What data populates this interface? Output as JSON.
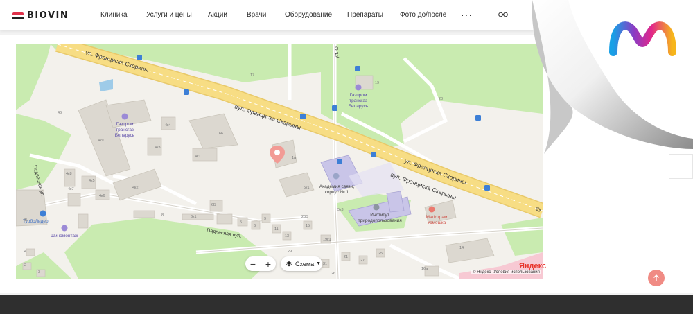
{
  "header": {
    "logo_text": "BIOVIN",
    "nav": [
      "Клиника",
      "Услуги и цены",
      "Акции",
      "Врачи",
      "Оборудование",
      "Препараты",
      "Фото до/после"
    ],
    "more": "···"
  },
  "map": {
    "streets": {
      "skaryny_top": "ул. Франциска Скорины",
      "skaryny_mid": "вул. Франциска Скарыны",
      "skaryny_right1": "ул. Франциска Скорины",
      "skaryny_right2": "вул. Франциска Скарыны",
      "padlesnaya": "Падлесная вул.",
      "podlesnaya": "Подлесная ул.",
      "cut_o": "ул. О",
      "cut_vu": "ву"
    },
    "pois": {
      "gazprom_top": [
        "Газпром",
        "трансгаз",
        "Беларусь"
      ],
      "gazprom_left": [
        "Газпром",
        "трансгаз",
        "Беларусь"
      ],
      "academy": [
        "Академия связи,",
        "корпус № 1"
      ],
      "institute": [
        "Институт",
        "природопользования"
      ],
      "beauty": [
        "Магістрам",
        "Усмешка"
      ],
      "turbolider": "ТурбоЛидер",
      "shinomontazh": "Шиномонтаж"
    },
    "house_numbers": [
      "17",
      "19",
      "20",
      "46",
      "4к9",
      "4к4",
      "4к3",
      "4к8",
      "4к5",
      "4к1",
      "4к7",
      "4к2",
      "4к6",
      "4Б",
      "66",
      "6к1",
      "6Б",
      "5к1",
      "5к3",
      "23Б",
      "1а",
      "14",
      "16а",
      "8",
      "4",
      "2",
      "3",
      "5",
      "6",
      "9",
      "11",
      "13",
      "15",
      "19к1",
      "21",
      "27",
      "31",
      "25",
      "29",
      "22",
      "24",
      "26"
    ],
    "zoom_minus": "−",
    "zoom_plus": "+",
    "layers_label": "Схема",
    "yandex": "Яндекс",
    "copyright": "© Яндекс",
    "terms": "Условия использования"
  },
  "colors": {
    "accent": "#e0314a",
    "scroll_top": "#f08b84",
    "footer": "#2f2f2f",
    "road_main": "#f7dd84",
    "park": "#c9ebb0",
    "building": "#dcd8d0"
  },
  "icons": {
    "glasses": "glasses-icon",
    "pin": "location-pin-icon",
    "layers": "layers-icon",
    "arrow_up": "arrow-up-icon",
    "bus": "bus-stop-icon",
    "brand": "m-logo-icon"
  }
}
